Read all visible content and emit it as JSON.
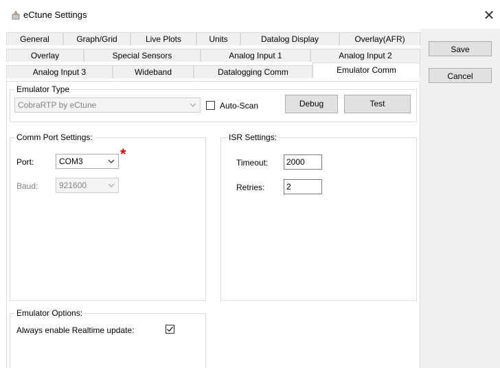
{
  "window": {
    "title": "eCtune Settings",
    "close_glyph": "✕"
  },
  "tabs": {
    "row1": [
      "General",
      "Graph/Grid",
      "Live Plots",
      "Units",
      "Datalog Display",
      "Overlay(AFR)"
    ],
    "row2": [
      "Overlay",
      "Special Sensors",
      "Analog Input 1",
      "Analog Input 2"
    ],
    "row3": [
      "Analog Input 3",
      "Wideband",
      "Datalogging Comm",
      "Emulator Comm"
    ],
    "active": "Emulator Comm"
  },
  "side_buttons": {
    "save": "Save",
    "cancel": "Cancel"
  },
  "emulator_type": {
    "title": "Emulator Type",
    "selected": "CobraRTP by eCtune",
    "auto_scan_label": "Auto-Scan",
    "auto_scan_checked": false,
    "debug_label": "Debug",
    "test_label": "Test"
  },
  "comm_port": {
    "title": "Comm Port Settings:",
    "port_label": "Port:",
    "port_value": "COM3",
    "baud_label": "Baud:",
    "baud_value": "921600",
    "required_marker": "*"
  },
  "isr": {
    "title": "ISR Settings:",
    "timeout_label": "Timeout:",
    "timeout_value": "2000",
    "retries_label": "Retries:",
    "retries_value": "2"
  },
  "emulator_options": {
    "title": "Emulator Options:",
    "realtime_label": "Always enable Realtime update:",
    "realtime_checked": true
  },
  "colors": {
    "accent_required": "#e00000",
    "disabled_text": "#838383"
  }
}
